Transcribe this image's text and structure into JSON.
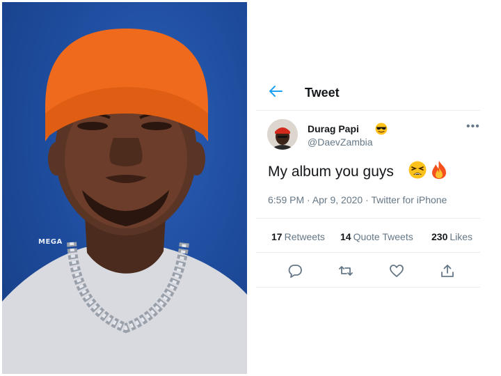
{
  "photo": {
    "watermark": "MEGA",
    "description_colors": {
      "background": "#1d4a9a",
      "hat": "#ef6a1c",
      "shirt": "#dcdde2"
    }
  },
  "tweet": {
    "header_title": "Tweet",
    "author": {
      "display_name": "Durag Papi",
      "handle": "@DaevZambia",
      "badge_emoji": "smiling-face-with-sunglasses-emoji"
    },
    "text": "My album you guys",
    "text_emojis": [
      "weary-face-emoji",
      "fire-emoji"
    ],
    "time": "6:59 PM",
    "date": "Apr 9, 2020",
    "source": "Twitter for iPhone",
    "stats": {
      "retweets_count": "17",
      "retweets_label": "Retweets",
      "quotes_count": "14",
      "quotes_label": "Quote Tweets",
      "likes_count": "230",
      "likes_label": "Likes"
    },
    "actions": [
      "reply-icon",
      "retweet-icon",
      "like-icon",
      "share-icon"
    ],
    "colors": {
      "accent": "#1da1f2",
      "muted": "#657786",
      "text": "#14171a",
      "divider": "#e6ecf0"
    }
  }
}
